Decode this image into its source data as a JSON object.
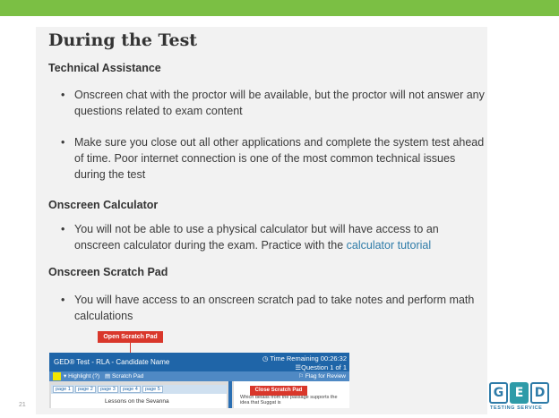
{
  "slide": {
    "title": "During the Test",
    "number": "21"
  },
  "sections": {
    "technical_assistance": {
      "heading": "Technical Assistance",
      "bullets": [
        "Onscreen chat with the proctor will be available, but the proctor will not answer any questions related to exam content",
        "Make sure you close out all other applications and complete the system test ahead of time. Poor internet connection is one of the most common technical issues during the test"
      ]
    },
    "calculator": {
      "heading": "Onscreen Calculator",
      "bullet_text": "You will not be able to use a physical calculator but will have access to an onscreen calculator during the exam. Practice with the ",
      "bullet_link": "calculator tutorial"
    },
    "scratch_pad": {
      "heading": "Onscreen Scratch Pad",
      "bullet": "You will have access to an onscreen scratch pad to take notes and perform math calculations"
    }
  },
  "screenshot": {
    "open_button": "Open Scratch Pad",
    "test_title": "GED® Test - RLA - Candidate Name",
    "time_remaining": "Time Remaining 00:26:32",
    "question_of": "Question 1 of 1",
    "highlight": "Highlight",
    "scratch_pad": "Scratch Pad",
    "flag": "Flag for Review",
    "tabs": [
      "page 1",
      "page 2",
      "page 3",
      "page 4",
      "page 5"
    ],
    "passage_title": "Lessons on the Sevanna",
    "close_button": "Close Scratch Pad",
    "right_text": "Which details from the passage supports the idea that Suggat is"
  },
  "logo": {
    "letters": [
      "G",
      "E",
      "D"
    ],
    "subtitle": "TESTING SERVICE"
  },
  "colors": {
    "top_bar": "#7bbf44",
    "link": "#2e7ba8",
    "button_red": "#d9372b",
    "header_blue": "#1f65a8"
  }
}
